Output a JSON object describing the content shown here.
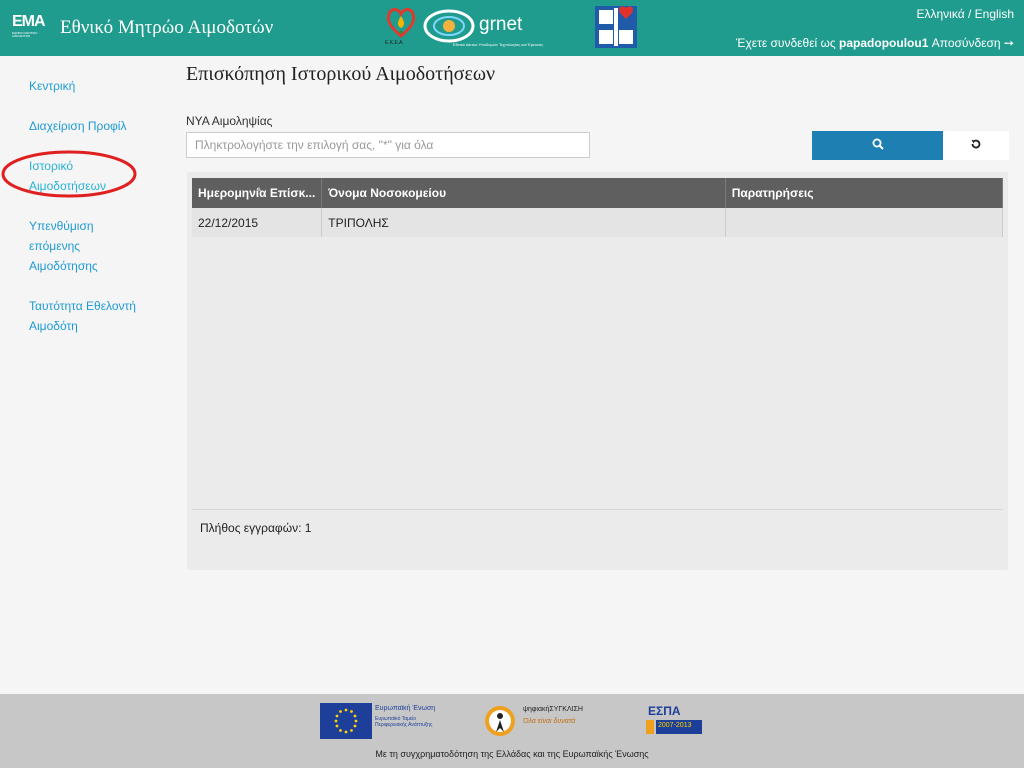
{
  "header": {
    "logo_text": "ΕΜΑ",
    "logo_subtext": "ΕΘΝΙΚΟ ΜΗΤΡΩΟ ΑΙΜΟΔΟΤΩΝ",
    "title": "Εθνικό Μητρώο Αιμοδοτών",
    "partners": {
      "elea_text": "Ε.Κ.Ε.Α.",
      "grnet_text": "grnet",
      "grnet_subtext": "Εθνικό Δίκτυο Υποδομών Τεχνολογίας και Έρευνας"
    },
    "language_switch": "Ελληνικά / English",
    "login_prefix": "Έχετε συνδεθεί ως",
    "username": "papadopoulou1",
    "logout_label": "Αποσύνδεση",
    "brand_color": "#1f9c8e"
  },
  "sidebar": {
    "items": [
      {
        "label": "Κεντρική"
      },
      {
        "label": "Διαχείριση Προφίλ"
      },
      {
        "label": "Ιστορικό Αιμοδοτήσεων"
      },
      {
        "label": "Υπενθύμιση επόμενης Αιμοδότησης"
      },
      {
        "label": "Ταυτότητα Εθελοντή Αιμοδότη"
      }
    ],
    "link_color": "#1e9bd7"
  },
  "main": {
    "page_title": "Επισκόπηση Ιστορικού Αιμοδοτήσεων",
    "filter_label": "ΝΥΑ Αιμοληψίας",
    "filter_placeholder": "Πληκτρολογήστε την επιλογή σας, \"*\" για όλα",
    "search_icon": "search-icon",
    "reset_icon": "reset-icon",
    "table": {
      "columns": [
        "Ημερομηνία Επίσκ...",
        "Όνομα Νοσοκομείου",
        "Παρατηρήσεις"
      ],
      "rows": [
        [
          "22/12/2015",
          "ΤΡΙΠΟΛΗΣ",
          ""
        ]
      ]
    },
    "record_count_text": "Πλήθος εγγραφών: 1"
  },
  "footer": {
    "eu_title": "Ευρωπαϊκή Ένωση",
    "eu_subtitle": "Ευρωπαϊκό Ταμείο Περιφερειακής Ανάπτυξης",
    "digital_title": "ψηφιακήΣΥΓΚΛΙΣΗ",
    "digital_subtitle": "Όλα είναι δυνατά",
    "espa_text": "ΕΣΠΑ",
    "espa_years": "2007-2013",
    "cofund_text": "Με τη συγχρηματοδότηση της Ελλάδας και της Ευρωπαϊκής Ένωσης"
  }
}
